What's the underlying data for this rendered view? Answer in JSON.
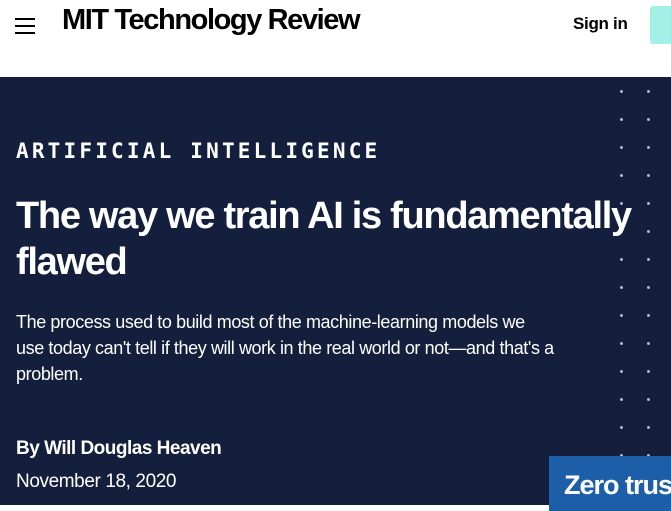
{
  "header": {
    "menu_icon": "hamburger-menu-icon",
    "logo": "MIT Technology Review",
    "signin_label": "Sign in"
  },
  "article": {
    "category": "ARTIFICIAL INTELLIGENCE",
    "title": "The way we train AI is fundamentally flawed",
    "dek": "The process used to build most of the machine-learning models we use today can't tell if they will work in the real world or not—and that's a problem.",
    "byline": "By Will Douglas Heaven",
    "date": "November 18, 2020"
  },
  "promo": {
    "text": "Zero trust"
  },
  "colors": {
    "hero_background": "#141f3d",
    "subscribe_accent": "#a3f0e6",
    "promo_background": "#1c5ea8"
  }
}
